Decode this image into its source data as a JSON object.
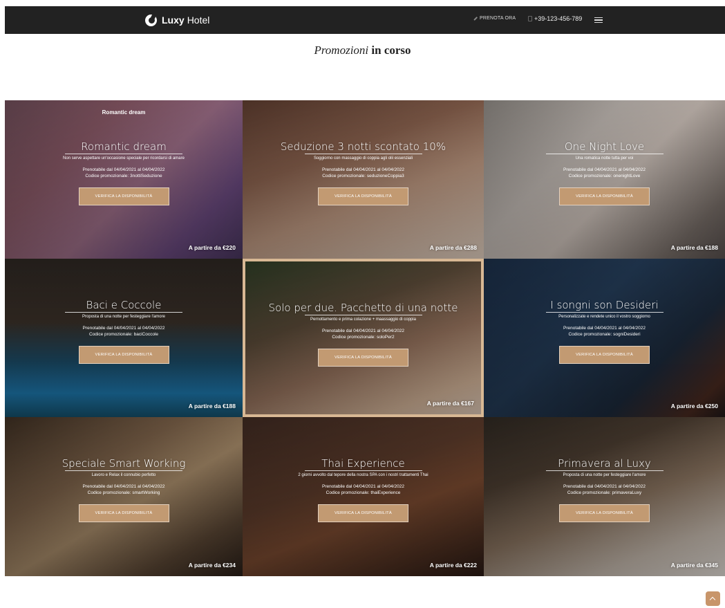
{
  "nav": {
    "brand_strong": "Luxy",
    "brand_light": "Hotel",
    "book_label": "PRENOTA ORA",
    "phone": "+39-123-456-789"
  },
  "page": {
    "heading_italic": "Promozioni",
    "heading_bold": "in corso"
  },
  "colors": {
    "navbar": "#222222",
    "button": "#c29a72",
    "highlight_border": "#d8b894",
    "scroll_top": "#c8956a"
  },
  "cards": [
    {
      "top_label": "Romantic dream",
      "title": "Romantic dream",
      "subtitle": "Non serve aspettare un'occasione speciale per ricordarsi di amare",
      "dates": "Prenotabile dal 04/04/2021 al 04/04/2022",
      "code": "Codice promozionale: 3nottiSeduzione",
      "button": "VERIFICA LA DISPONIBILITÀ",
      "price": "A partire da €220",
      "bg": "linear-gradient(135deg,#6a4a55 0%,#8b5a68 30%,#a0708a 55%,#6b4a80 80%,#4a3760 100%)"
    },
    {
      "top_label": "",
      "title": "Seduzione 3 notti scontato 10%",
      "subtitle": "Soggiorno con massaggio di coppia agli olii essenziali",
      "dates": "Prenotabile dal 04/04/2021 al 04/04/2022",
      "code": "Codice promozionale: seduzioneCoppia3",
      "button": "VERIFICA LA DISPONIBILITÀ",
      "price": "A partire da €288",
      "bg": "linear-gradient(160deg,#5b3b2e 0%,#8d6450 35%,#c29c84 60%,#e8d6c6 100%)"
    },
    {
      "top_label": "",
      "title": "One Night Love",
      "subtitle": "Una romatica notte tutta per voi",
      "dates": "Prenotabile dal 04/04/2021 al 04/04/2022",
      "code": "Codice promozionale: onenightLove",
      "button": "VERIFICA LA DISPONIBILITÀ",
      "price": "A partire da €188",
      "bg": "linear-gradient(135deg,#8a8580 0%,#c6beb8 35%,#d4c8c0 55%,#7a706a 85%,#5a5250 100%)"
    },
    {
      "top_label": "",
      "title": "Baci e Coccole",
      "subtitle": "Proposta di una notte per festeggiare l'amore",
      "dates": "Prenotabile dal 04/04/2021 al 04/04/2022",
      "code": "Codice promozionale: baciCoccole",
      "button": "VERIFICA LA DISPONIBILITÀ",
      "price": "A partire da €188",
      "bg": "linear-gradient(180deg,#2a2420 0%,#3a3028 40%,#1c4d6a 65%,#1e7ab0 85%,#15526e 100%)"
    },
    {
      "top_label": "",
      "title": "Solo per due. Pacchetto di una notte",
      "subtitle": "Pernottamento e prima colazione + maassaggio di coppia",
      "dates": "Prenotabile dal 04/04/2021 al 04/04/2022",
      "code": "Codice promozionale: soloPer2",
      "button": "VERIFICA LA DISPONIBILITÀ",
      "price": "A partire da €167",
      "bg": "linear-gradient(160deg,#2c3a24 0%,#5a4a38 35%,#9a7660 60%,#d8b89c 85%,#e6d0be 100%)"
    },
    {
      "top_label": "",
      "title": "I songni son Desideri",
      "subtitle": "Personalizzate e rendete unico il vostro soggiorno",
      "dates": "Prenotabile dal 04/04/2021 al 04/04/2022",
      "code": "Codice promozionale: sogniDesideri",
      "button": "VERIFICA LA DISPONIBILITÀ",
      "price": "A partire da €250",
      "bg": "linear-gradient(135deg,#1a2c44 0%,#243c58 40%,#1c2a3c 70%,#4a2a20 90%,#201818 100%)"
    },
    {
      "top_label": "",
      "title": "Speciale Smart Working",
      "subtitle": "Lavoro e Relax il connubio perfetto",
      "dates": "Prenotabile dal 04/04/2021 al 04/04/2022",
      "code": "Codice promozionale: smartWorking",
      "button": "VERIFICA LA DISPONIBILITÀ",
      "price": "A partire da €234",
      "bg": "linear-gradient(150deg,#3a2c20 0%,#7a6048 35%,#a88c6a 55%,#5a4634 80%,#2a1f18 100%)"
    },
    {
      "top_label": "",
      "title": "Thai Experience",
      "subtitle": "2 giorni avvolto dal tepore della nostra SPA con i nostri trattamenti Thai",
      "dates": "Prenotabile dal 04/04/2021 al 04/04/2022",
      "code": "Codice promozionale: thaiExperience",
      "button": "VERIFICA LA DISPONIBILITÀ",
      "price": "A partire da €222",
      "bg": "linear-gradient(160deg,#3c2820 0%,#5a3a2a 40%,#7a4a30 60%,#2a1a14 100%)"
    },
    {
      "top_label": "",
      "title": "Primavera al Luxy",
      "subtitle": "Proposta di una notte per festeggiare l'amore",
      "dates": "Prenotabile dal 04/04/2021 al 04/04/2022",
      "code": "Codice promozionale: primaveraLuxy",
      "button": "VERIFICA LA DISPONIBILITÀ",
      "price": "A partire da €345",
      "bg": "linear-gradient(160deg,#2c2620 0%,#4a3c30 30%,#8a7460 55%,#c8bcb0 80%,#e8e2dc 100%)"
    }
  ]
}
